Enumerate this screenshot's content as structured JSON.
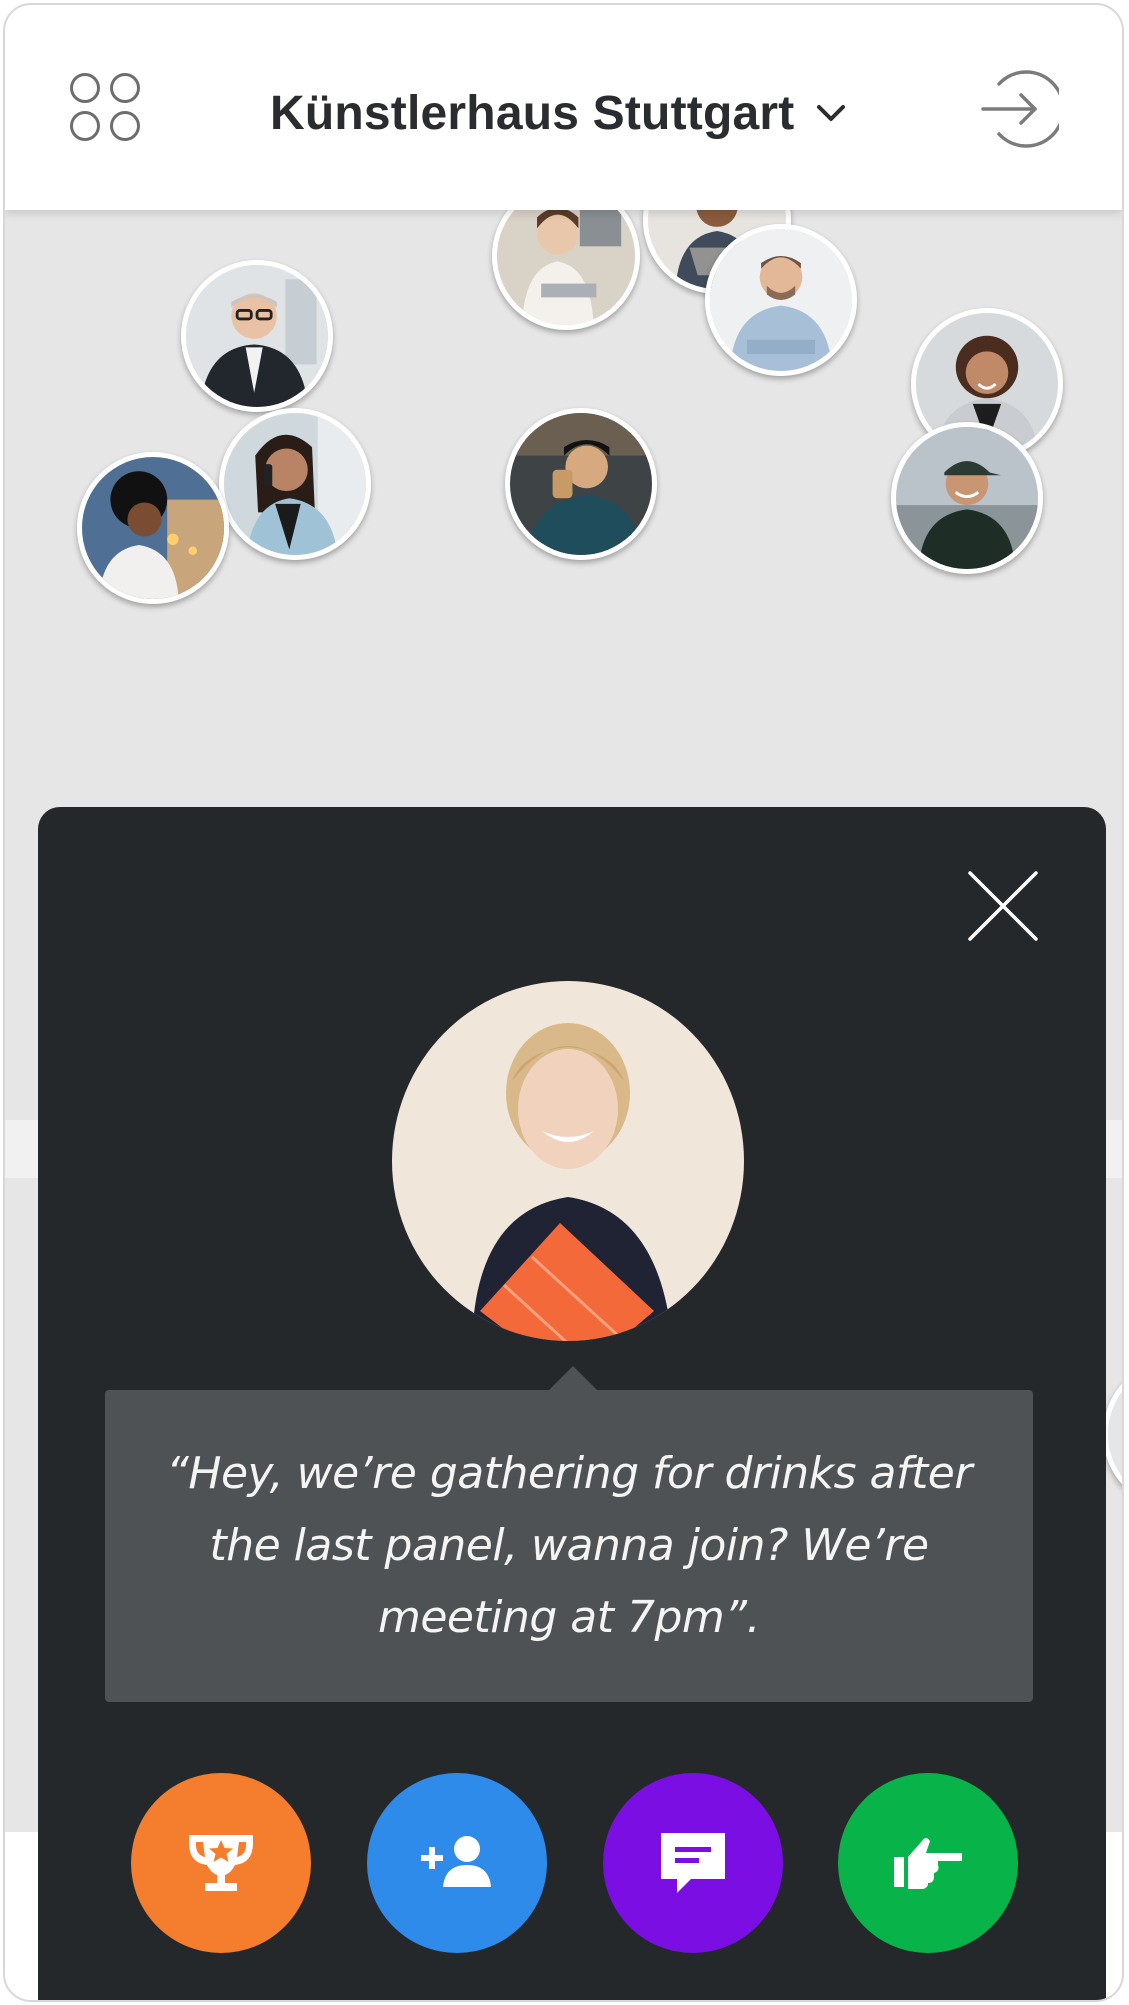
{
  "header": {
    "venue_name": "Künstlerhaus Stuttgart",
    "menu_icon": "grid-icon",
    "venue_dropdown_icon": "chevron-down-icon",
    "login_icon": "sign-in-icon"
  },
  "profile": {
    "message": "“Hey, we’re gathering for drinks after the last panel, wanna join? We’re meeting at 7pm”.",
    "close_icon": "close-icon"
  },
  "actions": [
    {
      "name": "award-button",
      "icon": "trophy-icon",
      "color": "#f47d2e"
    },
    {
      "name": "add-contact-button",
      "icon": "add-person-icon",
      "color": "#2f8bea"
    },
    {
      "name": "message-button",
      "icon": "chat-icon",
      "color": "#7b0ee2"
    },
    {
      "name": "point-button",
      "icon": "pointing-hand-icon",
      "color": "#08b449"
    }
  ],
  "colors": {
    "sheet_background": "#25282b",
    "bubble_background": "#4f5254",
    "map_background": "#e6e6e6"
  }
}
